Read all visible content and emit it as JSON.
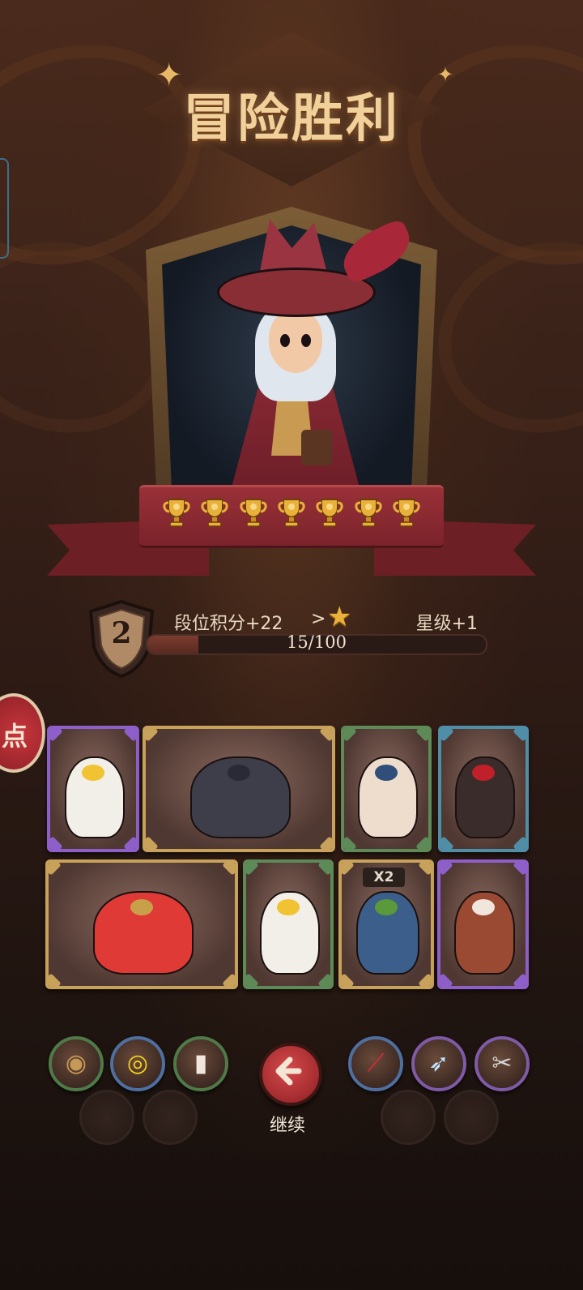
{
  "title": "冒险胜利",
  "hero": {
    "name_icon": "pirate-hero-portrait",
    "trophy_count": 7
  },
  "rank": {
    "level": "2",
    "points_label": "段位积分+22",
    "arrow": ">",
    "star_icon": "star-icon",
    "star_label": "星级+1",
    "progress_text": "15/100",
    "progress_value": 0.15
  },
  "side_button": {
    "label": "点"
  },
  "cards": [
    {
      "creature": "white-cockatoo",
      "rarity_color": "#8e5fc8"
    },
    {
      "creature": "raccoon-wizard",
      "rarity_color": "#c8a15a"
    },
    {
      "creature": "rabbit-scarecrow",
      "rarity_color": "#5e8a58"
    },
    {
      "creature": "dark-werewolf",
      "rarity_color": "#4f8ea6"
    },
    {
      "creature": "octopus-drummer",
      "rarity_color": "#c8a15a"
    },
    {
      "creature": "white-cockatoo",
      "rarity_color": "#5e8a58"
    },
    {
      "creature": "frog-samurai",
      "rarity_color": "#c8a15a",
      "badge": "X2"
    },
    {
      "creature": "fox-bard",
      "rarity_color": "#8e5fc8"
    }
  ],
  "skills_left": [
    {
      "icon": "rock-pile-icon",
      "ring": "#4f7a48"
    },
    {
      "icon": "eye-vortex-icon",
      "ring": "#4f6fa0"
    },
    {
      "icon": "playing-cards-icon",
      "ring": "#4f7a48"
    }
  ],
  "skills_right": [
    {
      "icon": "red-claw-icon",
      "ring": "#4f6fa0"
    },
    {
      "icon": "blade-slash-icon",
      "ring": "#7f5aa8"
    },
    {
      "icon": "pliers-icon",
      "ring": "#7f5aa8"
    }
  ],
  "continue": {
    "icon": "arrow-left-icon",
    "label": "继续"
  },
  "colors": {
    "title": "#f1d09a",
    "ribbon": "#8a2a32",
    "button_red": "#c03a3c"
  }
}
